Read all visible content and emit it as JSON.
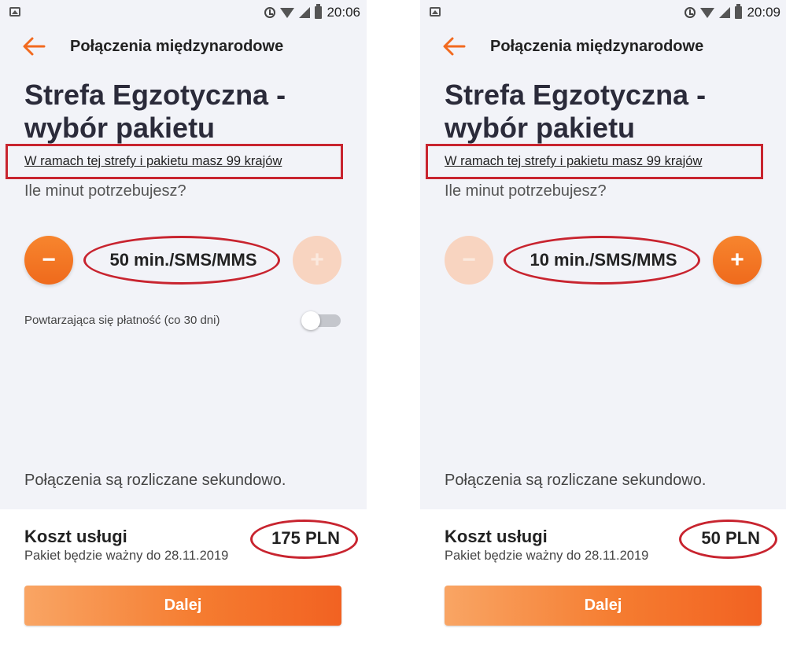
{
  "screens": [
    {
      "status": {
        "time": "20:06"
      },
      "nav_title": "Połączenia międzynarodowe",
      "heading_line1": "Strefa Egzotyczna -",
      "heading_line2": "wybór pakietu",
      "countries_link": "W ramach tej strefy i pakietu masz 99 krajów",
      "question": "Ile minut potrzebujesz?",
      "minus_label": "−",
      "plus_label": "+",
      "minus_enabled": true,
      "plus_enabled": false,
      "amount": "50 min./SMS/MMS",
      "recurring_label": "Powtarzająca się płatność (co 30 dni)",
      "recurring_on": false,
      "billing_note": "Połączenia są rozliczane sekundowo.",
      "cost_label": "Koszt usługi",
      "price": "175 PLN",
      "valid_until": "Pakiet będzie ważny do 28.11.2019",
      "cta_label": "Dalej"
    },
    {
      "status": {
        "time": "20:09"
      },
      "nav_title": "Połączenia międzynarodowe",
      "heading_line1": "Strefa Egzotyczna -",
      "heading_line2": "wybór pakietu",
      "countries_link": "W ramach tej strefy i pakietu masz 99 krajów",
      "question": "Ile minut potrzebujesz?",
      "minus_label": "−",
      "plus_label": "+",
      "minus_enabled": false,
      "plus_enabled": true,
      "amount": "10 min./SMS/MMS",
      "recurring_label": "",
      "billing_note": "Połączenia są rozliczane sekundowo.",
      "cost_label": "Koszt usługi",
      "price": "50 PLN",
      "valid_until": "Pakiet będzie ważny do 28.11.2019",
      "cta_label": "Dalej"
    }
  ],
  "colors": {
    "accent": "#f26a1f",
    "annotation_red": "#c8242f",
    "background": "#f2f3f8"
  }
}
